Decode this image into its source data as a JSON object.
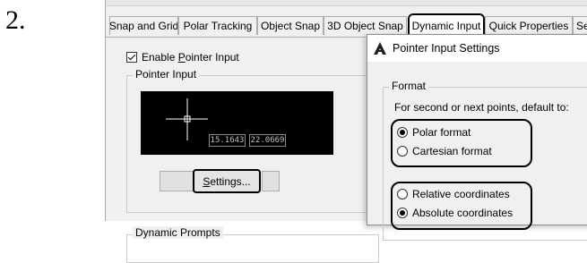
{
  "step_number": "2.",
  "tabs": [
    {
      "label": "Snap and Grid"
    },
    {
      "label": "Polar Tracking"
    },
    {
      "label": "Object Snap"
    },
    {
      "label": "3D Object Snap"
    },
    {
      "label": "Dynamic Input",
      "active": true
    },
    {
      "label": "Quick Properties"
    },
    {
      "label": "Sele"
    }
  ],
  "enable_pointer_input": {
    "label": "Enable Pointer Input",
    "mnemonic": "P",
    "checked": true
  },
  "pointer_input_group": {
    "title": "Pointer Input",
    "preview_coords": [
      "15.1643",
      "22.0669"
    ],
    "settings_button": {
      "label": "Settings...",
      "mnemonic": "S"
    }
  },
  "dynamic_prompts_group": {
    "title": "Dynamic Prompts"
  },
  "pointer_input_settings": {
    "title": "Pointer Input Settings",
    "icon": "autocad-icon",
    "format_group": {
      "title": "Format",
      "instruction": "For second or next points, default to:",
      "options": [
        {
          "label": "Polar format",
          "selected": true
        },
        {
          "label": "Cartesian format",
          "selected": false
        },
        {
          "label": "Relative coordinates",
          "selected": false
        },
        {
          "label": "Absolute coordinates",
          "selected": true
        }
      ]
    }
  },
  "colors": {
    "dialog_bg": "#f0f0f0",
    "preview_bg": "#000000"
  }
}
